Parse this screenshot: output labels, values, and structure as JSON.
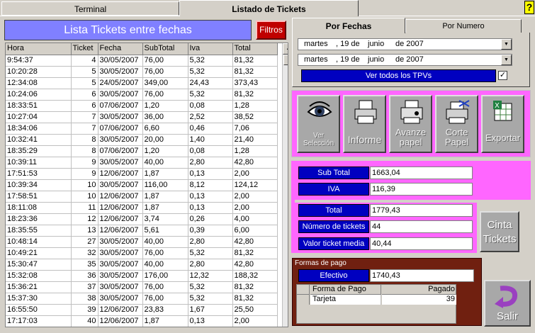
{
  "tabs": {
    "terminal": "Terminal",
    "listado": "Listado de Tickets",
    "help": "?"
  },
  "header": {
    "title": "Lista Tickets entre fechas",
    "filtros": "Filtros"
  },
  "table": {
    "columns": [
      "Hora",
      "Ticket",
      "Fecha",
      "SubTotal",
      "Iva",
      "Total"
    ],
    "rows": [
      [
        "9:54:37",
        "4",
        "30/05/2007",
        "76,00",
        "5,32",
        "81,32"
      ],
      [
        "10:20:28",
        "5",
        "30/05/2007",
        "76,00",
        "5,32",
        "81,32"
      ],
      [
        "12:34:08",
        "5",
        "24/05/2007",
        "349,00",
        "24,43",
        "373,43"
      ],
      [
        "10:24:06",
        "6",
        "30/05/2007",
        "76,00",
        "5,32",
        "81,32"
      ],
      [
        "18:33:51",
        "6",
        "07/06/2007",
        "1,20",
        "0,08",
        "1,28"
      ],
      [
        "10:27:04",
        "7",
        "30/05/2007",
        "36,00",
        "2,52",
        "38,52"
      ],
      [
        "18:34:06",
        "7",
        "07/06/2007",
        "6,60",
        "0,46",
        "7,06"
      ],
      [
        "10:32:41",
        "8",
        "30/05/2007",
        "20,00",
        "1,40",
        "21,40"
      ],
      [
        "18:35:29",
        "8",
        "07/06/2007",
        "1,20",
        "0,08",
        "1,28"
      ],
      [
        "10:39:11",
        "9",
        "30/05/2007",
        "40,00",
        "2,80",
        "42,80"
      ],
      [
        "17:51:53",
        "9",
        "12/06/2007",
        "1,87",
        "0,13",
        "2,00"
      ],
      [
        "10:39:34",
        "10",
        "30/05/2007",
        "116,00",
        "8,12",
        "124,12"
      ],
      [
        "17:58:51",
        "10",
        "12/06/2007",
        "1,87",
        "0,13",
        "2,00"
      ],
      [
        "18:11:08",
        "11",
        "12/06/2007",
        "1,87",
        "0,13",
        "2,00"
      ],
      [
        "18:23:36",
        "12",
        "12/06/2007",
        "3,74",
        "0,26",
        "4,00"
      ],
      [
        "18:35:55",
        "13",
        "12/06/2007",
        "5,61",
        "0,39",
        "6,00"
      ],
      [
        "10:48:14",
        "27",
        "30/05/2007",
        "40,00",
        "2,80",
        "42,80"
      ],
      [
        "10:49:21",
        "32",
        "30/05/2007",
        "76,00",
        "5,32",
        "81,32"
      ],
      [
        "15:30:47",
        "35",
        "30/05/2007",
        "40,00",
        "2,80",
        "42,80"
      ],
      [
        "15:32:08",
        "36",
        "30/05/2007",
        "176,00",
        "12,32",
        "188,32"
      ],
      [
        "15:36:21",
        "37",
        "30/05/2007",
        "76,00",
        "5,32",
        "81,32"
      ],
      [
        "15:37:30",
        "38",
        "30/05/2007",
        "76,00",
        "5,32",
        "81,32"
      ],
      [
        "16:55:50",
        "39",
        "12/06/2007",
        "23,83",
        "1,67",
        "25,50"
      ],
      [
        "17:17:03",
        "40",
        "12/06/2007",
        "1,87",
        "0,13",
        "2,00"
      ]
    ]
  },
  "filter": {
    "tab_fechas": "Por Fechas",
    "tab_numero": "Por Numero",
    "date1": {
      "day": "martes",
      "num": ", 19 de",
      "month": "junio",
      "year": "de 2007"
    },
    "date2": {
      "day": "martes",
      "num": ", 19 de",
      "month": "junio",
      "year": "de 2007"
    },
    "tpvs": "Ver todos los TPVs",
    "tpvs_checked": "✓"
  },
  "actions": {
    "ver": "Ver Selección",
    "informe": "Informe",
    "avanze": "Avanze papel",
    "corte": "Corte Papel",
    "exportar": "Exportar"
  },
  "summary": {
    "subtotal_label": "Sub Total",
    "subtotal": "1663,04",
    "iva_label": "IVA",
    "iva": "116,39",
    "total_label": "Total",
    "total": "1779,43",
    "num_label": "Número de tickets",
    "num": "44",
    "media_label": "Valor ticket media",
    "media": "40,44",
    "cinta": "Cinta Tickets"
  },
  "payment": {
    "title": "Formas de pago",
    "efectivo_label": "Efectivo",
    "efectivo": "1740,43",
    "col_forma": "Forma de Pago",
    "col_pagado": "Pagado",
    "rows": [
      [
        "Tarjeta",
        "39"
      ]
    ]
  },
  "salir": "Salir"
}
